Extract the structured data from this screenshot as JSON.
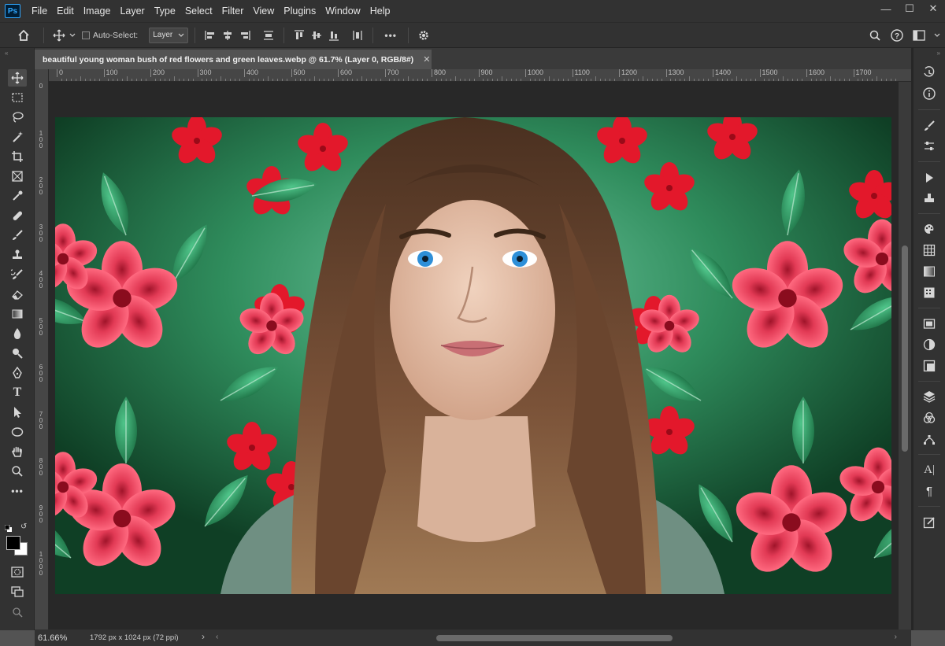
{
  "app": {
    "logo_text": "Ps"
  },
  "menu": [
    "File",
    "Edit",
    "Image",
    "Layer",
    "Type",
    "Select",
    "Filter",
    "View",
    "Plugins",
    "Window",
    "Help"
  ],
  "window_controls": {
    "minimize": "—",
    "maximize": "☐",
    "close": "✕"
  },
  "options_bar": {
    "auto_select_label": "Auto-Select:",
    "auto_select_checked": false,
    "layer_select_value": "Layer",
    "more_label": "•••"
  },
  "document": {
    "tab_title": "beautiful young woman bush of red flowers and green leaves.webp @ 61.7% (Layer 0, RGB/8#)",
    "close_glyph": "✕"
  },
  "ruler": {
    "h_labels": [
      "0",
      "100",
      "200",
      "300",
      "400",
      "500",
      "600",
      "700",
      "800",
      "900",
      "1000",
      "1100",
      "1200",
      "1300",
      "1400",
      "1500",
      "1600",
      "1700"
    ],
    "v_labels": [
      "0",
      "1\n0\n0",
      "2\n0\n0",
      "3\n0\n0",
      "4\n0\n0",
      "5\n0\n0",
      "6\n0\n0",
      "7\n0\n0",
      "8\n0\n0",
      "9\n0\n0",
      "1\n0\n0\n0"
    ]
  },
  "status": {
    "zoom": "61.66%",
    "doc_size": "1792 px x 1024 px (72 ppi)",
    "arrow": "›"
  },
  "colors": {
    "foreground": "#000000",
    "background": "#ffffff",
    "accent": "#31a8ff"
  }
}
